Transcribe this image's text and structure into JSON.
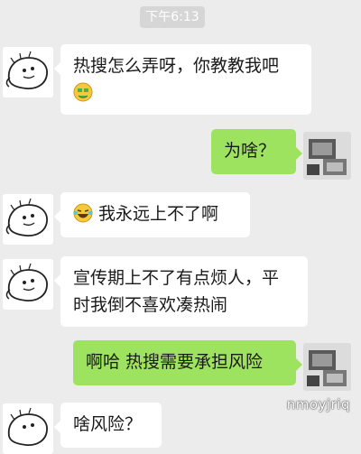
{
  "status": {
    "time": "下午6:13"
  },
  "messages": [
    {
      "side": "left",
      "lines": [
        "热搜怎么弄呀，你教教我吧"
      ],
      "emoji": "moneybag-face-emoji"
    },
    {
      "side": "right",
      "lines": [
        "为啥？"
      ]
    },
    {
      "side": "left",
      "lines": [
        "我永远上不了啊"
      ],
      "emoji": "crying-laughing-emoji"
    },
    {
      "side": "left",
      "lines": [
        "宣传期上不了有点烦人，平",
        "时我倒不喜欢凑热闹"
      ]
    },
    {
      "side": "right",
      "lines": [
        "啊哈 热搜需要承担风险"
      ]
    },
    {
      "side": "left",
      "lines": [
        "啥风险？"
      ]
    }
  ],
  "watermark": "nmoyjriq",
  "colors": {
    "background": "#ececec",
    "incoming_bubble": "#ffffff",
    "outgoing_bubble": "#9ee35f",
    "time_badge": "#d6d6d6"
  }
}
